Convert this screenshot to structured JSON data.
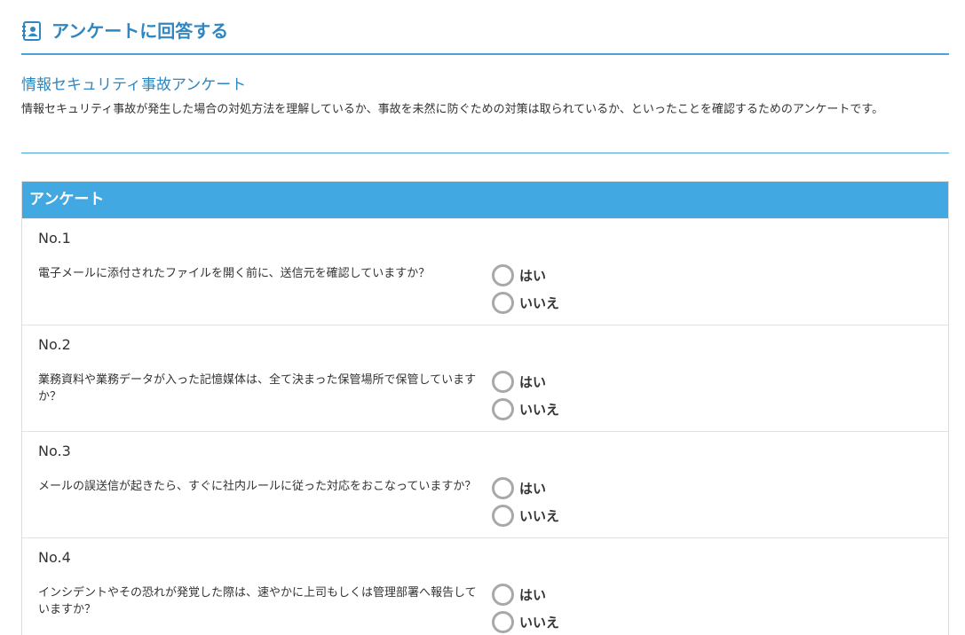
{
  "header": {
    "icon": "contact-card-icon",
    "title": "アンケートに回答する"
  },
  "intro": {
    "title": "情報セキュリティ事故アンケート",
    "description": "情報セキュリティ事故が発生した場合の対処方法を理解しているか、事故を未然に防ぐための対策は取られているか、といったことを確認するためのアンケートです。"
  },
  "survey": {
    "heading": "アンケート",
    "options": {
      "yes": "はい",
      "no": "いいえ"
    },
    "questions": [
      {
        "no": "No.1",
        "text": "電子メールに添付されたファイルを開く前に、送信元を確認していますか？"
      },
      {
        "no": "No.2",
        "text": "業務資料や業務データが入った記憶媒体は、全て決まった保管場所で保管していますか？"
      },
      {
        "no": "No.3",
        "text": "メールの誤送信が起きたら、すぐに社内ルールに従った対応をおこなっていますか？"
      },
      {
        "no": "No.4",
        "text": "インシデントやその恐れが発覚した際は、速やかに上司もしくは管理部署へ報告していますか？"
      }
    ]
  },
  "colors": {
    "accent": "#2f86c1",
    "header_bar": "#41a8e2",
    "radio_border": "#a8a8a8"
  }
}
